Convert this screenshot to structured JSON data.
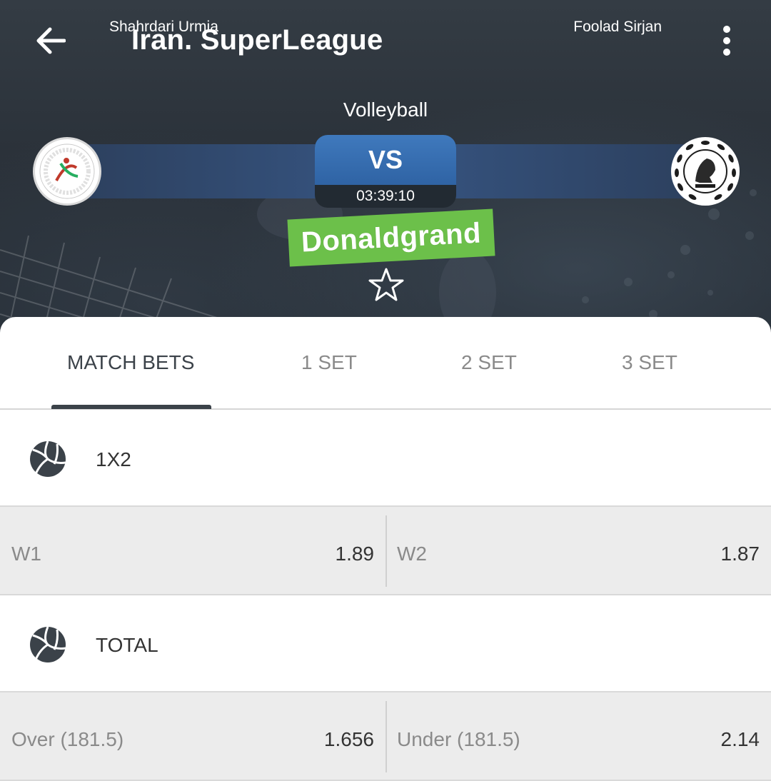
{
  "header": {
    "title": "Iran. SuperLeague",
    "sport": "Volleyball"
  },
  "match": {
    "team1": {
      "name": "Shahrdari Urmia",
      "logo": "urmia-logo"
    },
    "team2": {
      "name": "Foolad Sirjan",
      "logo": "foolad-logo"
    },
    "vs_label": "VS",
    "countdown": "03:39:10"
  },
  "watermark": "Donaldgrand",
  "tabs": [
    {
      "label": "MATCH BETS",
      "active": true
    },
    {
      "label": "1 SET",
      "active": false
    },
    {
      "label": "2 SET",
      "active": false
    },
    {
      "label": "3 SET",
      "active": false
    }
  ],
  "markets": [
    {
      "title": "1X2",
      "icon": "volleyball-icon",
      "outcomes": [
        {
          "name": "W1",
          "odd": "1.89"
        },
        {
          "name": "W2",
          "odd": "1.87"
        }
      ]
    },
    {
      "title": "TOTAL",
      "icon": "volleyball-icon",
      "outcomes": [
        {
          "name": "Over (181.5)",
          "odd": "1.656"
        },
        {
          "name": "Under (181.5)",
          "odd": "2.14"
        }
      ]
    }
  ],
  "colors": {
    "header_bg": "#2b323a",
    "vs_blue": "#3f79bd",
    "team_bar": "#34507a",
    "watermark_green": "#6cc04a",
    "active_tab": "#3b4249",
    "odds_row_bg": "#ececec"
  }
}
